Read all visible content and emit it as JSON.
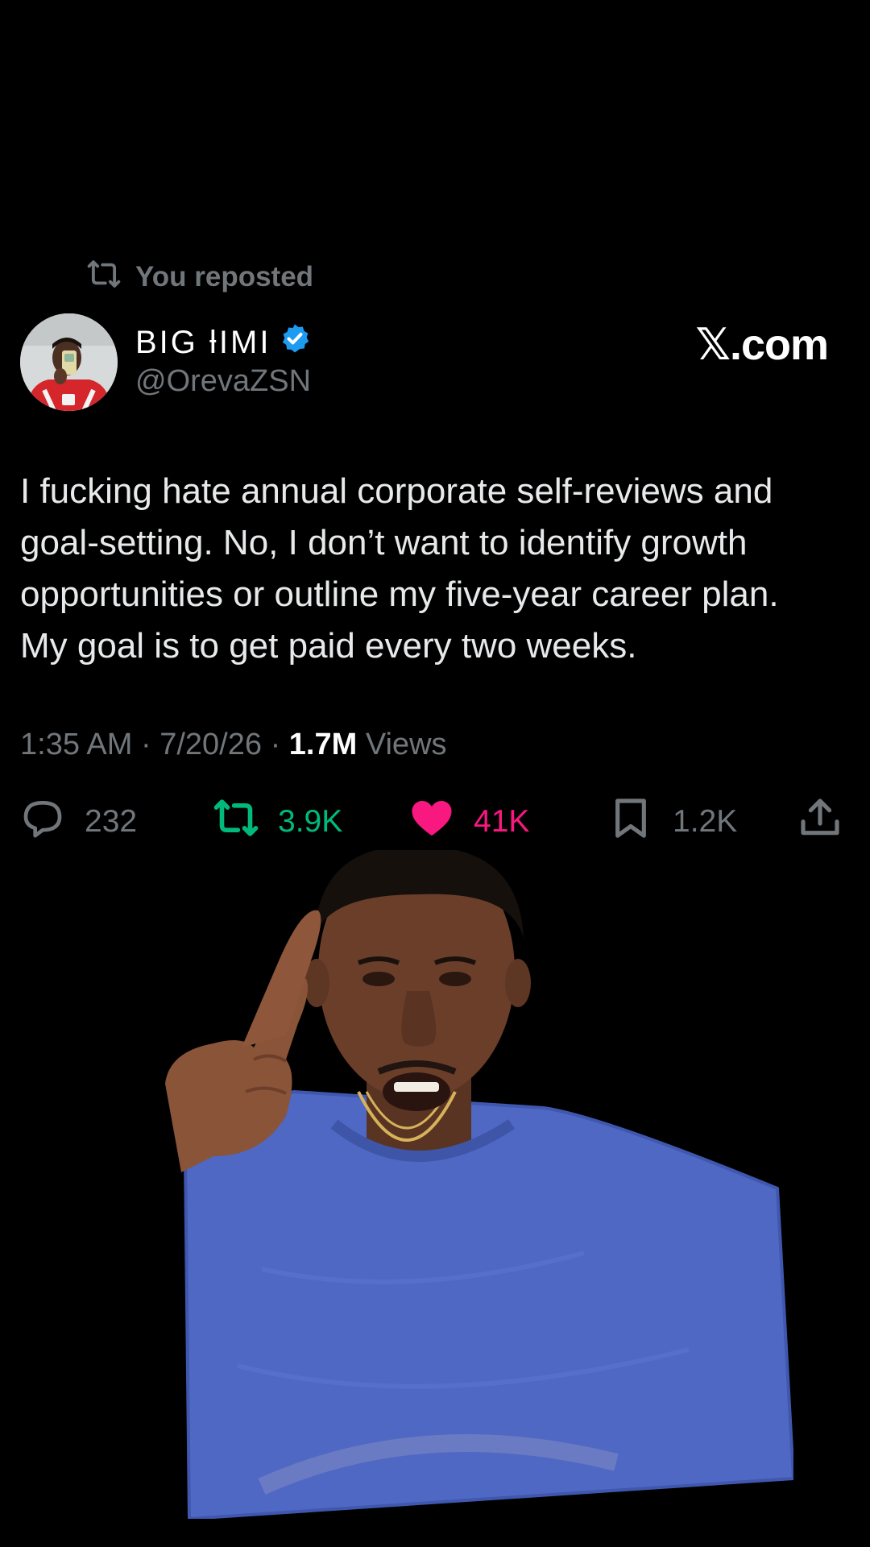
{
  "repost": {
    "label": "You reposted"
  },
  "author": {
    "display_name": "BIG ƚIMI",
    "handle": "@OrevaZSN",
    "verified": true
  },
  "brand": {
    "text": "𝕏.com"
  },
  "post": {
    "text": "I fucking hate annual corporate self-reviews and\ngoal-setting. No, I don’t want to identify growth\nopportunities or outline my five-year career plan.\nMy goal is to get paid every two weeks.",
    "time": "1:35 AM",
    "separator": "·",
    "date": "7/20/26",
    "views_count": "1.7M",
    "views_label": "Views"
  },
  "actions": {
    "replies": "232",
    "reposts": "3.9K",
    "likes": "41K",
    "bookmarks": "1.2K"
  },
  "icons": {
    "repost_header": "repost-icon",
    "verified": "verified-badge-icon",
    "reply": "comment-icon",
    "repost": "repost-icon",
    "like": "heart-icon",
    "bookmark": "bookmark-icon",
    "share": "share-icon"
  },
  "colors": {
    "background": "#000000",
    "text_primary": "#e7e9ea",
    "text_secondary": "#71767b",
    "verified_blue": "#1d9bf0",
    "repost_green": "#00ba7c",
    "like_pink": "#f91880",
    "shirt_blue": "#4f68c3"
  }
}
